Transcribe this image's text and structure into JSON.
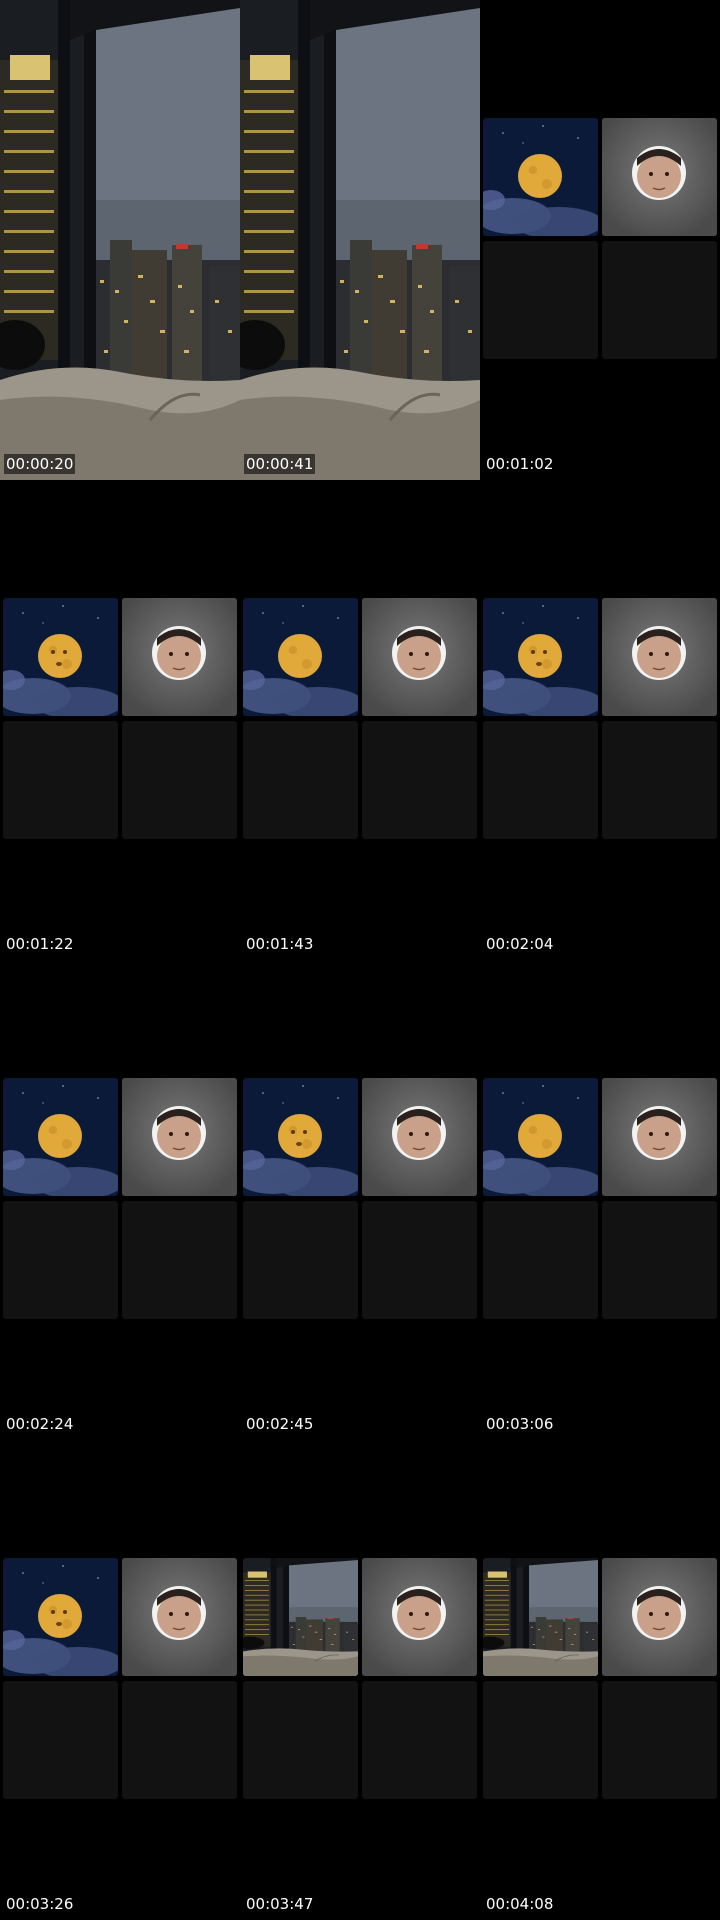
{
  "frames": [
    {
      "time": "00:00:20",
      "kind": "city"
    },
    {
      "time": "00:00:41",
      "kind": "city"
    },
    {
      "time": "00:01:02",
      "kind": "moon",
      "variant": "plain"
    },
    {
      "time": "00:01:22",
      "kind": "moon",
      "variant": "face"
    },
    {
      "time": "00:01:43",
      "kind": "moon",
      "variant": "plain"
    },
    {
      "time": "00:02:04",
      "kind": "moon",
      "variant": "face"
    },
    {
      "time": "00:02:24",
      "kind": "moon",
      "variant": "plain"
    },
    {
      "time": "00:02:45",
      "kind": "moon",
      "variant": "face"
    },
    {
      "time": "00:03:06",
      "kind": "moon",
      "variant": "plain"
    },
    {
      "time": "00:03:26",
      "kind": "moon",
      "variant": "face"
    },
    {
      "time": "00:03:47",
      "kind": "citytile"
    },
    {
      "time": "00:04:08",
      "kind": "citytile"
    }
  ],
  "colors": {
    "background": "#000000",
    "timestamp": "#ffffff",
    "night_sky": "#0c1a3a",
    "moon": "#e0a93a",
    "tile_empty": "#121212",
    "tile_face": "#5a5a5a"
  }
}
